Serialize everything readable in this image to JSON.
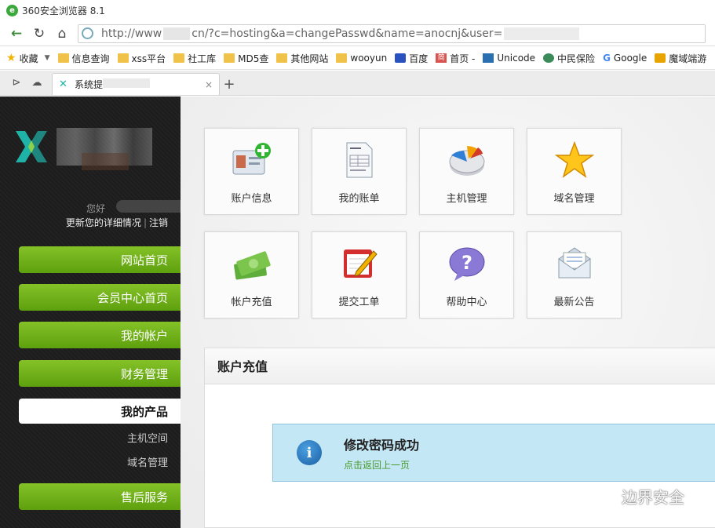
{
  "window": {
    "title": "360安全浏览器 8.1",
    "logo_glyph": "e"
  },
  "address": {
    "prefix": "http://www",
    "middle": "cn/?c=hosting&a=changePasswd&name=anocnj&user=",
    "back_icon": "←",
    "reload_icon": "↻",
    "home_icon": "⌂"
  },
  "bookmarks": {
    "favorites": "收藏",
    "items": [
      {
        "label": "信息查询"
      },
      {
        "label": "xss平台"
      },
      {
        "label": "社工库"
      },
      {
        "label": "MD5查"
      },
      {
        "label": "其他网站"
      },
      {
        "label": "wooyun"
      },
      {
        "label": "百度"
      },
      {
        "label": "首页 -"
      },
      {
        "label": "Unicode"
      },
      {
        "label": "中民保险"
      },
      {
        "label": "Google"
      },
      {
        "label": "魔域端游"
      }
    ],
    "jian_glyph": "简",
    "g_glyph": "G"
  },
  "tabs": {
    "active_label": "系统提",
    "close": "×",
    "add": "+"
  },
  "sidebar": {
    "hello": "您好",
    "update_link": "更新您的详细情况",
    "separator": "|",
    "logout_link": "注销",
    "menu": [
      {
        "label": "网站首页"
      },
      {
        "label": "会员中心首页"
      },
      {
        "label": "我的帐户"
      },
      {
        "label": "财务管理"
      },
      {
        "label": "我的产品"
      },
      {
        "label": "售后服务"
      }
    ],
    "sub_items": [
      {
        "label": "主机空间"
      },
      {
        "label": "域名管理"
      }
    ]
  },
  "tiles": [
    {
      "label": "账户信息",
      "icon": "id-card-add-icon"
    },
    {
      "label": "我的账单",
      "icon": "bill-document-icon"
    },
    {
      "label": "主机管理",
      "icon": "pie-chart-icon"
    },
    {
      "label": "域名管理",
      "icon": "star-icon"
    },
    {
      "label": "帐户充值",
      "icon": "money-icon"
    },
    {
      "label": "提交工单",
      "icon": "edit-note-icon"
    },
    {
      "label": "帮助中心",
      "icon": "question-bubble-icon"
    },
    {
      "label": "最新公告",
      "icon": "mail-icon"
    }
  ],
  "panel": {
    "title": "账户充值",
    "notice_title": "修改密码成功",
    "notice_link": "点击返回上一页",
    "notice_icon_glyph": "i"
  },
  "watermark": {
    "text": "边界安全"
  },
  "colors": {
    "menu_green": "#6fb01b",
    "notice_bg": "#c4e7f5",
    "link_green": "#4a9a2a"
  }
}
